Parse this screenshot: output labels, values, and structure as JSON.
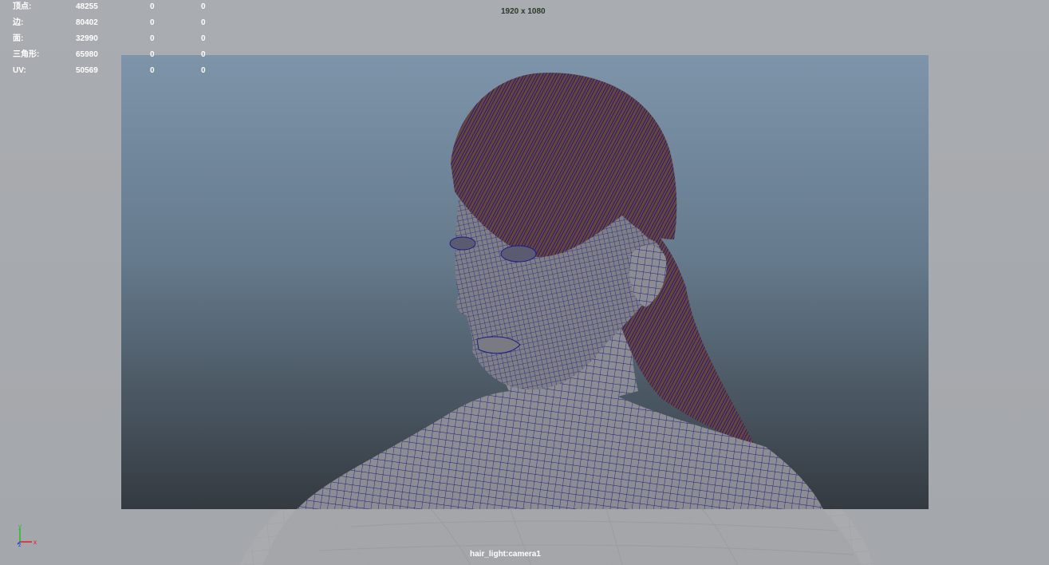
{
  "hud": {
    "rows": [
      {
        "label": "顶点:",
        "total": "48255",
        "selected": "0",
        "uv_shell": "0"
      },
      {
        "label": "边:",
        "total": "80402",
        "selected": "0",
        "uv_shell": "0"
      },
      {
        "label": "面:",
        "total": "32990",
        "selected": "0",
        "uv_shell": "0"
      },
      {
        "label": "三角形:",
        "total": "65980",
        "selected": "0",
        "uv_shell": "0"
      },
      {
        "label": "UV:",
        "total": "50569",
        "selected": "0",
        "uv_shell": "0"
      }
    ]
  },
  "resolution_gate": {
    "text": "1920 x 1080"
  },
  "camera": {
    "name": "hair_light:camera1"
  },
  "axis": {
    "x_label": "x",
    "y_label": "y",
    "z_label": "z",
    "x_color": "#e02020",
    "y_color": "#20c020",
    "z_color": "#2040e0"
  },
  "colors": {
    "wire": "#1a1a8c",
    "hair": "#6a4a3a",
    "skin": "#8a8a90",
    "bg_outer": "#a6a9ad"
  }
}
